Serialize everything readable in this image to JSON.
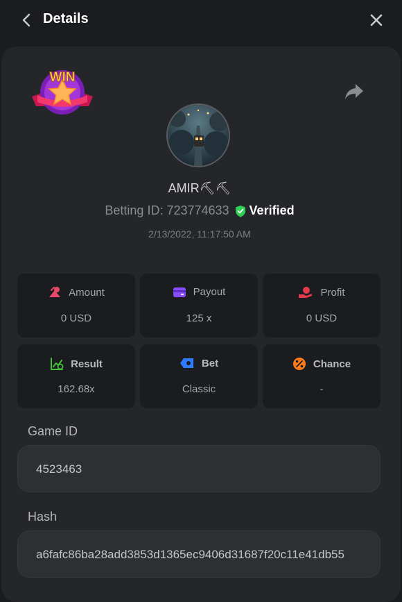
{
  "header": {
    "title": "Details"
  },
  "user": {
    "name": "AMIR⛏⛏",
    "betting_id_label": "Betting ID: 723774633",
    "verified_label": "Verified",
    "timestamp": "2/13/2022, 11:17:50 AM"
  },
  "badge": {
    "text": "WIN"
  },
  "stats": [
    {
      "label": "Amount",
      "value": "0 USD",
      "icon": "amount-icon",
      "color": "#e8496b"
    },
    {
      "label": "Payout",
      "value": "125 x",
      "icon": "payout-icon",
      "color": "#8a4cff"
    },
    {
      "label": "Profit",
      "value": "0 USD",
      "icon": "profit-icon",
      "color": "#e83a4a"
    },
    {
      "label": "Result",
      "value": "162.68x",
      "icon": "result-icon",
      "color": "#45c23a"
    },
    {
      "label": "Bet",
      "value": "Classic",
      "icon": "bet-icon",
      "color": "#2f7bff"
    },
    {
      "label": "Chance",
      "value": "-",
      "icon": "chance-icon",
      "color": "#ff7a1a"
    }
  ],
  "fields": {
    "game_id_label": "Game ID",
    "game_id_value": "4523463",
    "hash_label": "Hash",
    "hash_value": "a6fafc86ba28add3853d1365ec9406d31687f20c11e41db55"
  },
  "colors": {
    "background": "#1b1c1f",
    "panel": "#252629",
    "verified": "#2fcf55"
  }
}
